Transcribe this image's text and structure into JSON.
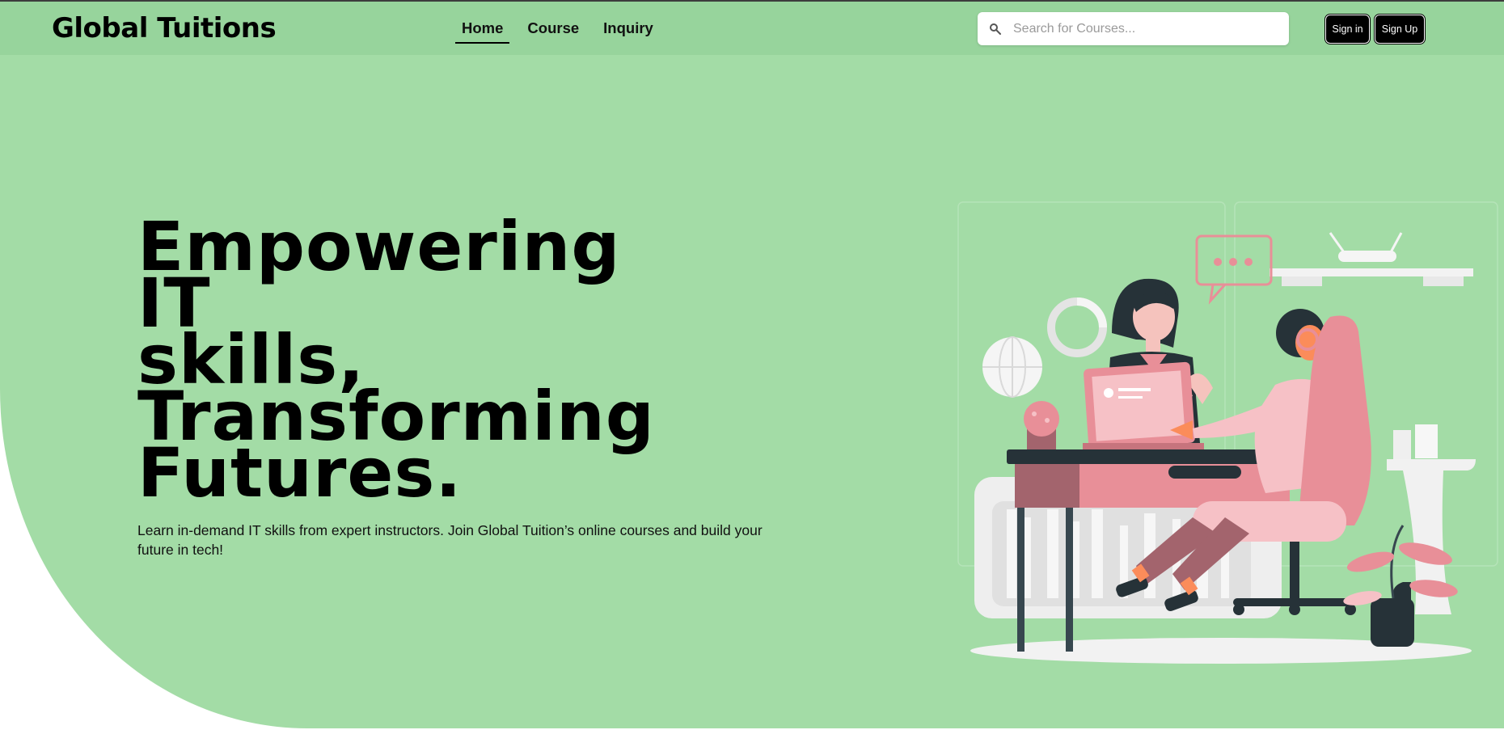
{
  "brand": {
    "name": "Global Tuitions"
  },
  "nav": {
    "items": [
      {
        "label": "Home",
        "active": true
      },
      {
        "label": "Course",
        "active": false
      },
      {
        "label": "Inquiry",
        "active": false
      }
    ]
  },
  "search": {
    "placeholder": "Search for Courses...",
    "value": "",
    "icon": "search-icon"
  },
  "auth": {
    "signin_label": "Sign in",
    "signup_label": "Sign Up"
  },
  "hero": {
    "headline_lines": [
      "Empowering",
      "IT",
      "skills,",
      "Transforming",
      "Futures."
    ],
    "subtext": "Learn in-demand IT skills from expert instructors. Join Global Tuition’s online courses and build your future in tech!",
    "illustration": "two-people-online-tutoring-illustration"
  },
  "colors": {
    "navbar_bg": "#97d49c",
    "hero_bg": "#a3dca6",
    "button_bg": "#000000",
    "accent_pink": "#e88f98"
  }
}
